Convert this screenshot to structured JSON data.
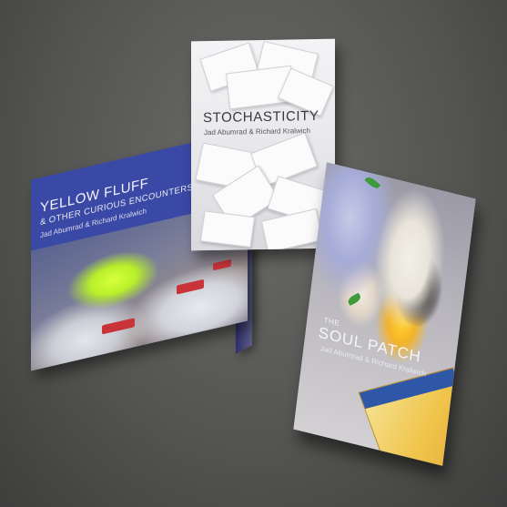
{
  "books": [
    {
      "title": "YELLOW FLUFF",
      "subtitle": "& OTHER CURIOUS ENCOUNTERS",
      "authors": "Jad Abumrad & Richard Kralwich"
    },
    {
      "title": "STOCHASTICITY",
      "authors": "Jad Abumrad & Richard Kralwich"
    },
    {
      "pre_title": "THE",
      "title": "SOUL PATCH",
      "authors": "Jad Abumrad & Richard Kralwich"
    }
  ],
  "colors": {
    "background": "#555553",
    "book1_cover": "#3b49a6",
    "book1_accent": "#b8f02a",
    "book2_cover": "#ececef",
    "book3_accent": "#f0c44a"
  }
}
